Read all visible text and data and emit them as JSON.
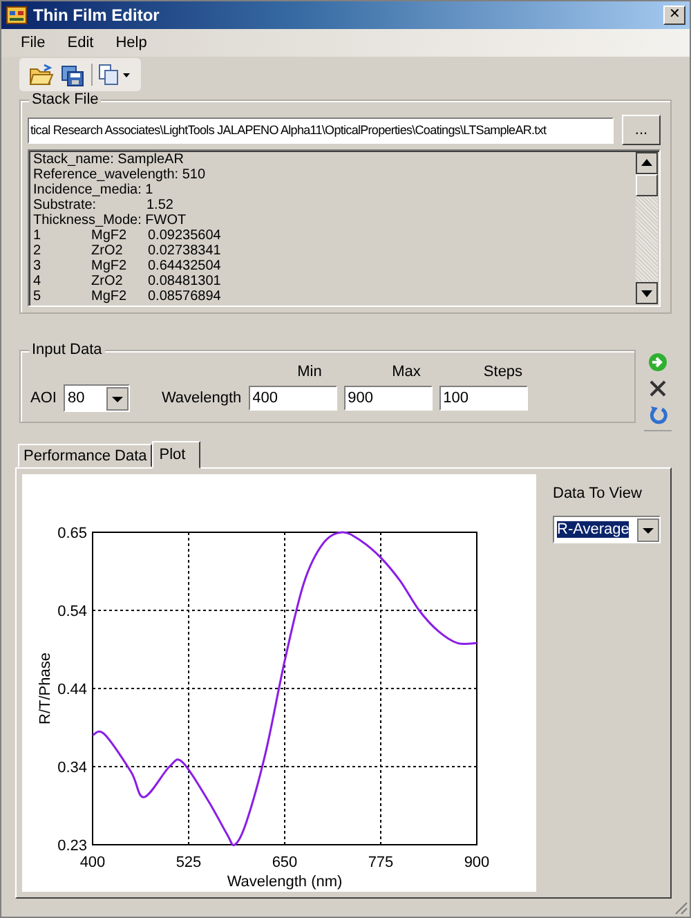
{
  "window": {
    "title": "Thin Film Editor",
    "close": "✕"
  },
  "menu": [
    {
      "label": "File"
    },
    {
      "label": "Edit"
    },
    {
      "label": "Help"
    }
  ],
  "stack_file": {
    "title": "Stack File",
    "path": "tical Research Associates\\LightTools JALAPENO Alpha11\\OpticalProperties\\Coatings\\LTSampleAR.txt",
    "browse": "...",
    "lines": [
      {
        "kind": "text",
        "text": "Stack_name: SampleAR"
      },
      {
        "kind": "text",
        "text": "Reference_wavelength: 510"
      },
      {
        "kind": "text",
        "text": "Incidence_media: 1"
      },
      {
        "kind": "pair",
        "cells": [
          "Substrate:",
          "1.52"
        ]
      },
      {
        "kind": "text",
        "text": "Thickness_Mode: FWOT"
      },
      {
        "kind": "layer",
        "cells": [
          "1",
          "MgF2",
          "0.09235604"
        ]
      },
      {
        "kind": "layer",
        "cells": [
          "2",
          "ZrO2",
          "0.02738341"
        ]
      },
      {
        "kind": "layer",
        "cells": [
          "3",
          "MgF2",
          "0.64432504"
        ]
      },
      {
        "kind": "layer",
        "cells": [
          "4",
          "ZrO2",
          "0.08481301"
        ]
      },
      {
        "kind": "layer",
        "cells": [
          "5",
          "MgF2",
          "0.08576894"
        ]
      }
    ]
  },
  "input_data": {
    "title": "Input Data",
    "aoi_label": "AOI",
    "aoi": "80",
    "wavelength_label": "Wavelength",
    "columns": [
      {
        "heading": "Min",
        "value": "400"
      },
      {
        "heading": "Max",
        "value": "900"
      },
      {
        "heading": "Steps",
        "value": "100"
      }
    ]
  },
  "tabs": [
    {
      "label": "Performance Data",
      "selected": false
    },
    {
      "label": "Plot",
      "selected": true
    }
  ],
  "plot": {
    "data_to_view_label": "Data To View",
    "data_to_view": "R-Average",
    "chart_data": {
      "type": "line",
      "xlabel": "Wavelength (nm)",
      "ylabel": "R/T/Phase",
      "x": [
        400,
        415,
        450,
        467,
        500,
        517,
        550,
        575,
        585,
        600,
        625,
        650,
        675,
        700,
        725,
        750,
        775,
        800,
        825,
        850,
        875,
        900
      ],
      "grid": true,
      "series": [
        {
          "color": "#8a1ee6",
          "values": [
            0.377,
            0.379,
            0.328,
            0.294,
            0.335,
            0.341,
            0.29,
            0.244,
            0.23,
            0.26,
            0.353,
            0.477,
            0.582,
            0.635,
            0.65,
            0.638,
            0.616,
            0.585,
            0.545,
            0.517,
            0.501,
            0.501
          ]
        }
      ],
      "xlim": [
        400,
        900
      ],
      "ylim": [
        0.23,
        0.65
      ],
      "xticks": [
        400,
        525,
        650,
        775,
        900
      ],
      "yticks": [
        0.23,
        {
          "value": 0.335,
          "label": "0.34"
        },
        0.44,
        {
          "value": 0.545,
          "label": "0.54"
        },
        0.65
      ]
    }
  }
}
